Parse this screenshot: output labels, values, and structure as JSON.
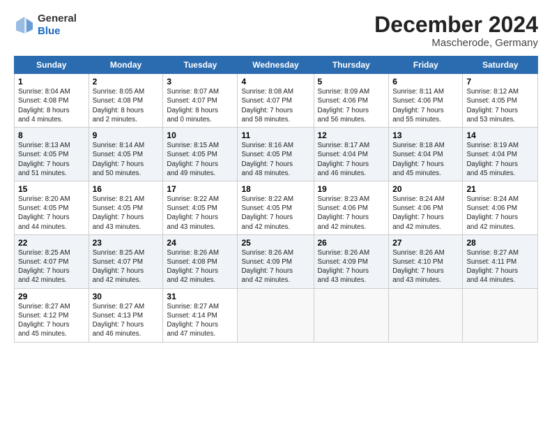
{
  "logo": {
    "general": "General",
    "blue": "Blue"
  },
  "header": {
    "title": "December 2024",
    "subtitle": "Mascherode, Germany"
  },
  "days_of_week": [
    "Sunday",
    "Monday",
    "Tuesday",
    "Wednesday",
    "Thursday",
    "Friday",
    "Saturday"
  ],
  "weeks": [
    [
      {
        "day": "1",
        "info": "Sunrise: 8:04 AM\nSunset: 4:08 PM\nDaylight: 8 hours\nand 4 minutes."
      },
      {
        "day": "2",
        "info": "Sunrise: 8:05 AM\nSunset: 4:08 PM\nDaylight: 8 hours\nand 2 minutes."
      },
      {
        "day": "3",
        "info": "Sunrise: 8:07 AM\nSunset: 4:07 PM\nDaylight: 8 hours\nand 0 minutes."
      },
      {
        "day": "4",
        "info": "Sunrise: 8:08 AM\nSunset: 4:07 PM\nDaylight: 7 hours\nand 58 minutes."
      },
      {
        "day": "5",
        "info": "Sunrise: 8:09 AM\nSunset: 4:06 PM\nDaylight: 7 hours\nand 56 minutes."
      },
      {
        "day": "6",
        "info": "Sunrise: 8:11 AM\nSunset: 4:06 PM\nDaylight: 7 hours\nand 55 minutes."
      },
      {
        "day": "7",
        "info": "Sunrise: 8:12 AM\nSunset: 4:05 PM\nDaylight: 7 hours\nand 53 minutes."
      }
    ],
    [
      {
        "day": "8",
        "info": "Sunrise: 8:13 AM\nSunset: 4:05 PM\nDaylight: 7 hours\nand 51 minutes."
      },
      {
        "day": "9",
        "info": "Sunrise: 8:14 AM\nSunset: 4:05 PM\nDaylight: 7 hours\nand 50 minutes."
      },
      {
        "day": "10",
        "info": "Sunrise: 8:15 AM\nSunset: 4:05 PM\nDaylight: 7 hours\nand 49 minutes."
      },
      {
        "day": "11",
        "info": "Sunrise: 8:16 AM\nSunset: 4:05 PM\nDaylight: 7 hours\nand 48 minutes."
      },
      {
        "day": "12",
        "info": "Sunrise: 8:17 AM\nSunset: 4:04 PM\nDaylight: 7 hours\nand 46 minutes."
      },
      {
        "day": "13",
        "info": "Sunrise: 8:18 AM\nSunset: 4:04 PM\nDaylight: 7 hours\nand 45 minutes."
      },
      {
        "day": "14",
        "info": "Sunrise: 8:19 AM\nSunset: 4:04 PM\nDaylight: 7 hours\nand 45 minutes."
      }
    ],
    [
      {
        "day": "15",
        "info": "Sunrise: 8:20 AM\nSunset: 4:05 PM\nDaylight: 7 hours\nand 44 minutes."
      },
      {
        "day": "16",
        "info": "Sunrise: 8:21 AM\nSunset: 4:05 PM\nDaylight: 7 hours\nand 43 minutes."
      },
      {
        "day": "17",
        "info": "Sunrise: 8:22 AM\nSunset: 4:05 PM\nDaylight: 7 hours\nand 43 minutes."
      },
      {
        "day": "18",
        "info": "Sunrise: 8:22 AM\nSunset: 4:05 PM\nDaylight: 7 hours\nand 42 minutes."
      },
      {
        "day": "19",
        "info": "Sunrise: 8:23 AM\nSunset: 4:06 PM\nDaylight: 7 hours\nand 42 minutes."
      },
      {
        "day": "20",
        "info": "Sunrise: 8:24 AM\nSunset: 4:06 PM\nDaylight: 7 hours\nand 42 minutes."
      },
      {
        "day": "21",
        "info": "Sunrise: 8:24 AM\nSunset: 4:06 PM\nDaylight: 7 hours\nand 42 minutes."
      }
    ],
    [
      {
        "day": "22",
        "info": "Sunrise: 8:25 AM\nSunset: 4:07 PM\nDaylight: 7 hours\nand 42 minutes."
      },
      {
        "day": "23",
        "info": "Sunrise: 8:25 AM\nSunset: 4:07 PM\nDaylight: 7 hours\nand 42 minutes."
      },
      {
        "day": "24",
        "info": "Sunrise: 8:26 AM\nSunset: 4:08 PM\nDaylight: 7 hours\nand 42 minutes."
      },
      {
        "day": "25",
        "info": "Sunrise: 8:26 AM\nSunset: 4:09 PM\nDaylight: 7 hours\nand 42 minutes."
      },
      {
        "day": "26",
        "info": "Sunrise: 8:26 AM\nSunset: 4:09 PM\nDaylight: 7 hours\nand 43 minutes."
      },
      {
        "day": "27",
        "info": "Sunrise: 8:26 AM\nSunset: 4:10 PM\nDaylight: 7 hours\nand 43 minutes."
      },
      {
        "day": "28",
        "info": "Sunrise: 8:27 AM\nSunset: 4:11 PM\nDaylight: 7 hours\nand 44 minutes."
      }
    ],
    [
      {
        "day": "29",
        "info": "Sunrise: 8:27 AM\nSunset: 4:12 PM\nDaylight: 7 hours\nand 45 minutes."
      },
      {
        "day": "30",
        "info": "Sunrise: 8:27 AM\nSunset: 4:13 PM\nDaylight: 7 hours\nand 46 minutes."
      },
      {
        "day": "31",
        "info": "Sunrise: 8:27 AM\nSunset: 4:14 PM\nDaylight: 7 hours\nand 47 minutes."
      },
      {
        "day": "",
        "info": ""
      },
      {
        "day": "",
        "info": ""
      },
      {
        "day": "",
        "info": ""
      },
      {
        "day": "",
        "info": ""
      }
    ]
  ]
}
